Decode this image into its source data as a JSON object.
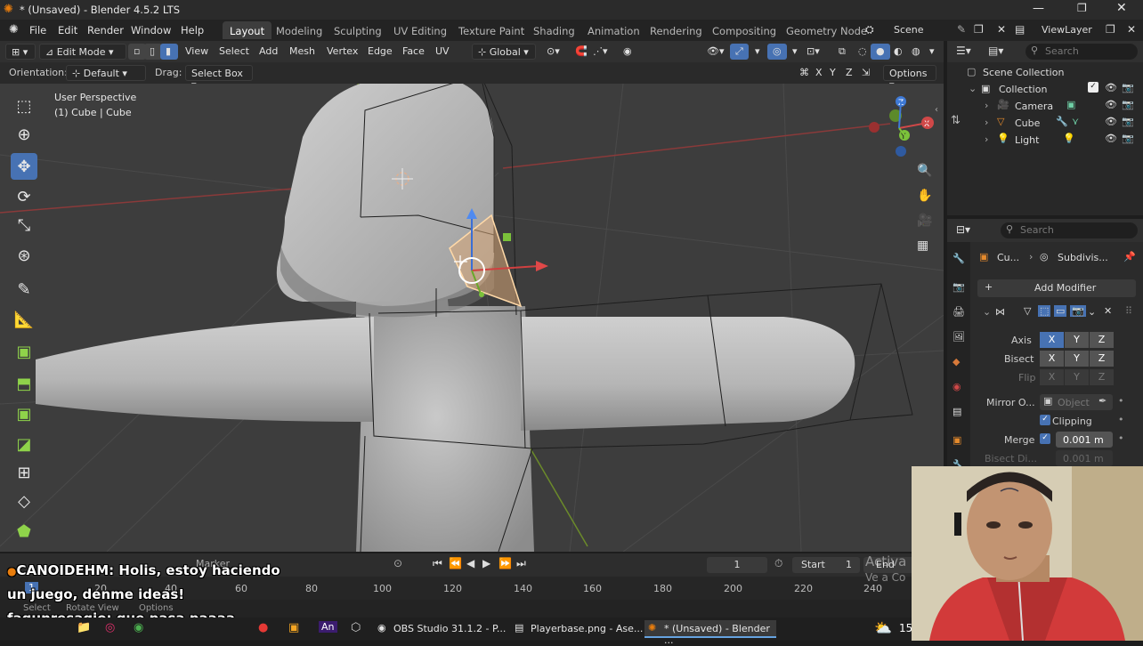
{
  "window": {
    "title": "* (Unsaved) - Blender 4.5.2 LTS"
  },
  "menu": [
    "File",
    "Edit",
    "Render",
    "Window",
    "Help"
  ],
  "workspaces": [
    "Layout",
    "Modeling",
    "Sculpting",
    "UV Editing",
    "Texture Paint",
    "Shading",
    "Animation",
    "Rendering",
    "Compositing",
    "Geometry Node"
  ],
  "scene": {
    "label": "Scene",
    "view_layer": "ViewLayer"
  },
  "header": {
    "mode": "Edit Mode",
    "menus": [
      "View",
      "Select",
      "Add",
      "Mesh",
      "Vertex",
      "Edge",
      "Face",
      "UV"
    ],
    "transform": "Global"
  },
  "toolhdr": {
    "orientation_label": "Orientation:",
    "orientation": "Default",
    "drag_label": "Drag:",
    "drag": "Select Box",
    "axes": [
      "X",
      "Y",
      "Z"
    ],
    "options": "Options"
  },
  "viewport": {
    "view_name": "User Perspective",
    "object_info": "(1) Cube | Cube"
  },
  "outliner": {
    "search": "Search",
    "root": "Scene Collection",
    "collection": "Collection",
    "items": [
      "Camera",
      "Cube",
      "Light"
    ]
  },
  "properties": {
    "search": "Search",
    "breadcrumb_obj": "Cu...",
    "breadcrumb_mod": "Subdivis...",
    "add_modifier": "Add Modifier",
    "axis_label": "Axis",
    "bisect_label": "Bisect",
    "flip_label": "Flip",
    "axes": [
      "X",
      "Y",
      "Z"
    ],
    "mirror_label": "Mirror O...",
    "mirror_placeholder": "Object",
    "clipping": "Clipping",
    "merge_label": "Merge",
    "merge_value": "0.001 m",
    "bisect_dist_label": "Bisect Di...",
    "bisect_dist_value": "0.001 m"
  },
  "timeline": {
    "current_frame": "1",
    "start_label": "Start",
    "start": "1",
    "end_label": "End",
    "ticks": [
      "20",
      "40",
      "60",
      "80",
      "100",
      "120",
      "140",
      "160",
      "180",
      "200",
      "220",
      "240"
    ],
    "bottom_left": [
      "Select",
      "Rotate View",
      "Options"
    ],
    "cursor_frame": "1"
  },
  "overlay": {
    "activate": "Activa",
    "goto": "Ve a Co"
  },
  "chat": [
    {
      "user": "CANOIDEHM:",
      "text": "Holis, estoy haciendo"
    },
    {
      "user": "",
      "text": "un juego, denme ideas!"
    },
    {
      "user": "faqunresagio:",
      "text": "que pasa paaaa"
    }
  ],
  "taskbar": {
    "tasks": [
      "OBS Studio 31.1.2 - P...",
      "Playerbase.png - Ase...",
      "* (Unsaved) - Blender ..."
    ],
    "clock": "15"
  },
  "colors": {
    "accent": "#4772b3",
    "viewport": "#3d3d3d",
    "selected_face": "#d8a878"
  }
}
